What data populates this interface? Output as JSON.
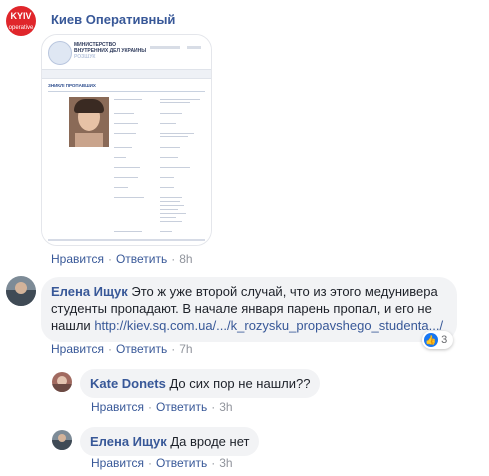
{
  "post_comment": {
    "author": "Киев Оперативный",
    "avatar_text": {
      "line1": "KYIV",
      "line2": "operative"
    },
    "screenshot": {
      "header_line1": "МИНИСТЕРСТВО",
      "header_line2": "ВНУТРЕННИХ ДЕЛ УКРАИНЫ",
      "header_line3": "РОЗШУК",
      "section_title": "ЗНИКЛІ ПРОПАВШИХ"
    },
    "actions": {
      "like": "Нравится",
      "reply": "Ответить",
      "time": "8h"
    }
  },
  "comments": [
    {
      "author": "Елена Ищук",
      "text": "Это ж уже второй случай, что из этого медунивера студенты пропадают. В начале января парень пропал, и его не нашли ",
      "link": "http://kiev.sq.com.ua/.../k_rozysku_propavshego_studenta.../",
      "reactions": "3",
      "actions": {
        "like": "Нравится",
        "reply": "Ответить",
        "time": "7h"
      }
    },
    {
      "author": "Kate Donets",
      "text": "До сих пор не нашли??",
      "actions": {
        "like": "Нравится",
        "reply": "Ответить",
        "time": "3h"
      }
    },
    {
      "author": "Елена Ищук",
      "text": "Да вроде нет",
      "actions": {
        "like": "Нравится",
        "reply": "Ответить",
        "time": "3h"
      }
    }
  ],
  "colors": {
    "name": "#385898",
    "bubble": "#f2f3f5",
    "like_blue": "#1877f2",
    "logo_red": "#e0262b"
  }
}
